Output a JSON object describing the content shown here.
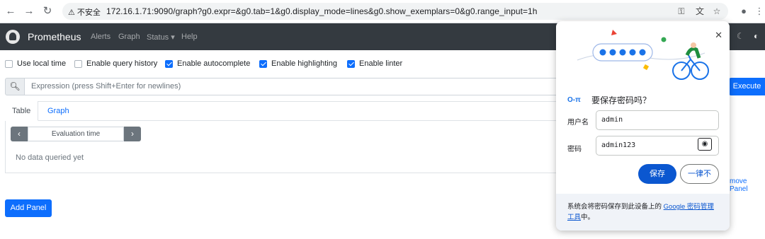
{
  "browser": {
    "security_label": "不安全",
    "url": "172.16.1.71:9090/graph?g0.expr=&g0.tab=1&g0.display_mode=lines&g0.show_exemplars=0&g0.range_input=1h"
  },
  "navbar": {
    "brand": "Prometheus",
    "links": [
      "Alerts",
      "Graph",
      "Status ▾",
      "Help"
    ]
  },
  "options": [
    {
      "label": "Use local time",
      "checked": false
    },
    {
      "label": "Enable query history",
      "checked": false
    },
    {
      "label": "Enable autocomplete",
      "checked": true
    },
    {
      "label": "Enable highlighting",
      "checked": true
    },
    {
      "label": "Enable linter",
      "checked": true
    }
  ],
  "expression": {
    "placeholder": "Expression (press Shift+Enter for newlines)",
    "execute_label": "Execute"
  },
  "panel": {
    "tabs": [
      "Table",
      "Graph"
    ],
    "eval_time_placeholder": "Evaluation time",
    "no_data": "No data queried yet",
    "remove_label": "move Panel"
  },
  "add_panel_label": "Add Panel",
  "password_popup": {
    "title": "要保存密码吗？",
    "username_label": "用户名",
    "username_value": "admin",
    "password_label": "密码",
    "password_value": "admin123",
    "save_label": "保存",
    "never_label": "一律不",
    "footer_text": "系统会将密码保存到此设备上的 ",
    "footer_link": "Google 密码管理工具",
    "footer_suffix": "中。"
  }
}
